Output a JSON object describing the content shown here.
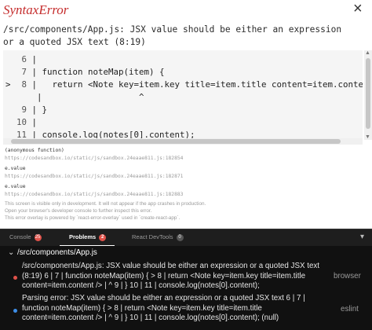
{
  "overlay": {
    "title": "SyntaxError",
    "message": "/src/components/App.js: JSX value should be either an expression or a quoted JSX text (8:19)",
    "close_glyph": "×",
    "code_lines": [
      {
        "num": "6",
        "text": " |",
        "arrow": ""
      },
      {
        "num": "7",
        "text": " | function noteMap(item) {",
        "arrow": ""
      },
      {
        "num": "8",
        "text": " |   return <Note key=item.key title=item.title content=item.content />",
        "arrow": ">"
      },
      {
        "num": "",
        "text": "  |                   ^",
        "arrow": ""
      },
      {
        "num": "9",
        "text": " | }",
        "arrow": ""
      },
      {
        "num": "10",
        "text": " |",
        "arrow": ""
      },
      {
        "num": "11",
        "text": " | console.log(notes[0].content);",
        "arrow": ""
      }
    ],
    "stack": [
      {
        "fn": "(anonymous function)",
        "url": "https://codesandbox.io/static/js/sandbox.24eaae811.js:182854"
      },
      {
        "fn": "e.value",
        "url": "https://codesandbox.io/static/js/sandbox.24eaae811.js:182871"
      },
      {
        "fn": "e.value",
        "url": "https://codesandbox.io/static/js/sandbox.24eaae811.js:182883"
      }
    ],
    "notes": [
      "This screen is visible only in development. It will not appear if the app crashes in production.",
      "Open your browser's developer console to further inspect this error.",
      "This error overlay is powered by `react-error-overlay` used in `create-react-app`."
    ]
  },
  "tabs": [
    {
      "label": "Console",
      "badge": "25"
    },
    {
      "label": "Problems",
      "badge": "2"
    },
    {
      "label": "React DevTools",
      "badge": "0"
    }
  ],
  "tabs_more_glyph": "▾",
  "problems": {
    "file": "/src/components/App.js",
    "items": [
      {
        "message": "/src/components/App.js: JSX value should be either an expression or a quoted JSX text (8:19) 6 | 7 | function noteMap(item) { > 8 | return <Note key=item.key title=item.title content=item.content /> | ^ 9 | } 10 | 11 | console.log(notes[0].content);",
        "source": "browser",
        "color": "#e0524a"
      },
      {
        "message": "Parsing error: JSX value should be either an expression or a quoted JSX text 6 | 7 | function noteMap(item) { > 8 | return <Note key=item.key title=item.title content=item.content /> | ^ 9 | } 10 | 11 | console.log(notes[0].content); (null)",
        "source": "eslint",
        "color": "#3d8ee8"
      }
    ]
  }
}
